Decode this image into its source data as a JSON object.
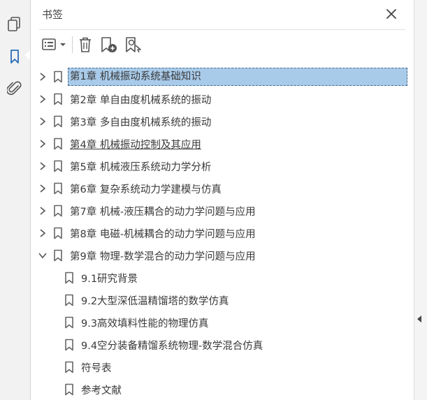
{
  "panel": {
    "title": "书签"
  },
  "rail": {
    "items": [
      {
        "icon": "pages-icon"
      },
      {
        "icon": "bookmark-icon",
        "active": true
      },
      {
        "icon": "attachment-icon"
      }
    ]
  },
  "toolbar": {
    "items": [
      {
        "icon": "options-menu-icon"
      },
      {
        "icon": "delete-icon"
      },
      {
        "icon": "new-bookmark-icon"
      },
      {
        "icon": "bookmark-search-icon"
      }
    ]
  },
  "bookmarks": [
    {
      "label": "第1章  机械振动系统基础知识",
      "level": 0,
      "expanded": false,
      "selected": true
    },
    {
      "label": "第2章  单自由度机械系统的振动",
      "level": 0,
      "expanded": false
    },
    {
      "label": "第3章  多自由度机械系统的振动",
      "level": 0,
      "expanded": false
    },
    {
      "label": "第4章  机械振动控制及其应用",
      "level": 0,
      "expanded": false,
      "underline": true
    },
    {
      "label": "第5章  机械液压系统动力学分析",
      "level": 0,
      "expanded": false
    },
    {
      "label": "第6章  复杂系统动力学建模与仿真",
      "level": 0,
      "expanded": false
    },
    {
      "label": "第7章  机械-液压耦合的动力学问题与应用",
      "level": 0,
      "expanded": false
    },
    {
      "label": "第8章  电磁-机械耦合的动力学问题与应用",
      "level": 0,
      "expanded": false
    },
    {
      "label": "第9章  物理-数学混合的动力学问题与应用",
      "level": 0,
      "expanded": true
    },
    {
      "label": "9.1研究背景",
      "level": 1
    },
    {
      "label": "9.2大型深低温精馏塔的数学仿真",
      "level": 1
    },
    {
      "label": "9.3高效填料性能的物理仿真",
      "level": 1
    },
    {
      "label": "9.4空分装备精馏系统物理-数学混合仿真",
      "level": 1
    },
    {
      "label": "符号表",
      "level": 1
    },
    {
      "label": "参考文献",
      "level": 1
    }
  ],
  "colors": {
    "selection": "#a9cbea",
    "icon": "#555555",
    "accent": "#2b6cb8"
  }
}
